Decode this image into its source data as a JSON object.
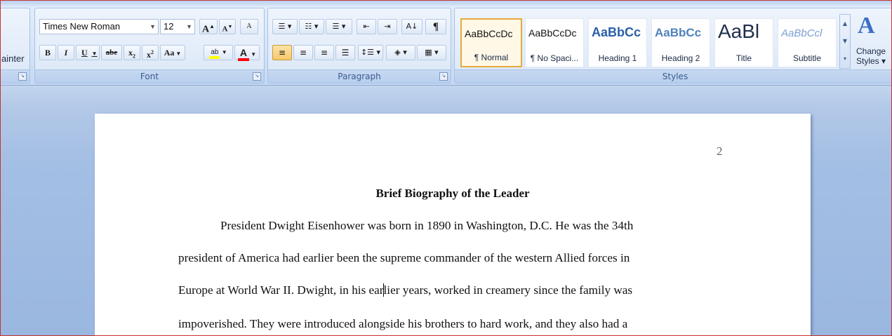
{
  "ribbon": {
    "clipboard": {
      "format_painter_partial": "ainter"
    },
    "font": {
      "label": "Font",
      "font_name": "Times New Roman",
      "font_size": "12",
      "grow_label": "A",
      "shrink_label": "A",
      "clear_format_label": "A",
      "bold_label": "B",
      "italic_label": "I",
      "underline_label": "U",
      "strike_label": "abe",
      "subscript_label": "x",
      "superscript_label": "x",
      "change_case_label": "Aa",
      "highlight_label": "ab",
      "font_color_label": "A",
      "highlight_color": "#ffff00",
      "font_color": "#ff0000"
    },
    "paragraph": {
      "label": "Paragraph",
      "pilcrow": "¶",
      "sort_label": "A↓"
    },
    "styles": {
      "label": "Styles",
      "items": [
        {
          "sample": "AaBbCcDc",
          "name": "¶ Normal",
          "color": "#111111"
        },
        {
          "sample": "AaBbCcDc",
          "name": "¶ No Spaci...",
          "color": "#111111"
        },
        {
          "sample": "AaBbCc",
          "name": "Heading 1",
          "color": "#2a5ea8"
        },
        {
          "sample": "AaBbCc",
          "name": "Heading 2",
          "color": "#4f81bd"
        },
        {
          "sample": "AaBl",
          "name": "Title",
          "color": "#1f2f4a"
        },
        {
          "sample": "AaBbCcl",
          "name": "Subtitle",
          "color": "#7ba0d4"
        }
      ],
      "change_styles_line1": "Change",
      "change_styles_line2": "Styles ▾"
    }
  },
  "document": {
    "page_number": "2",
    "title": "Brief Biography of the Leader",
    "lines": [
      "President Dwight Eisenhower was born in 1890 in Washington, D.C. He was the 34th",
      "president of America had earlier been the supreme commander of the western Allied forces in",
      "Europe at World War II. Dwight, in his ear",
      "lier years, worked in creamery since the family was",
      "impoverished. They were introduced alongside his brothers to hard work, and they also had a"
    ]
  }
}
